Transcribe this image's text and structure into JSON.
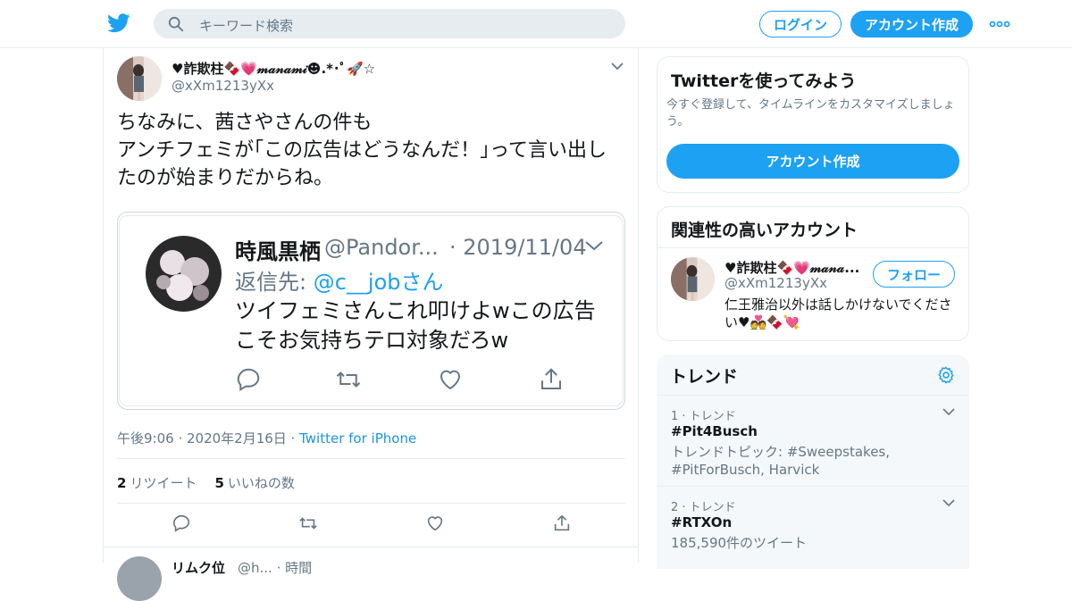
{
  "topbar": {
    "search_placeholder": "キーワード検索",
    "login_label": "ログイン",
    "signup_label": "アカウント作成"
  },
  "tweet": {
    "display_name": "♥詐欺柱🍫💗𝓂𝒶𝓃𝒶𝓂𝒾☻.*･ﾟ🚀☆",
    "handle": "@xXm1213yXx",
    "text": "ちなみに、茜さやさんの件も\nアンチフェミが｢この広告はどうなんだ！｣って言い出したのが始まりだからね。",
    "embedded": {
      "name": "時風黒栖",
      "handle": "@Pandor...",
      "date": "· 2019/11/04",
      "reply_prefix": "返信先: ",
      "reply_to": "@c__jobさん",
      "text": "ツイフェミさんこれ叩けよwこの広告\nこそお気持ちテロ対象だろw"
    },
    "timestamp": "午後9:06 · 2020年2月16日 · ",
    "source": "Twitter for iPhone",
    "retweet_count": "2",
    "retweet_label": "リツイート",
    "like_count": "5",
    "like_label": "いいねの数"
  },
  "next_tweet": {
    "name": "リムク位",
    "handle": "@h...  · 時間"
  },
  "signup_card": {
    "title": "Twitterを使ってみよう",
    "subtitle": "今すぐ登録して、タイムラインをカスタマイズしましょう。",
    "button": "アカウント作成"
  },
  "related_card": {
    "title": "関連性の高いアカウント",
    "name": "♥詐欺柱🍫💗𝓂𝒶𝓃𝒶...",
    "handle": "@xXm1213yXx",
    "follow_label": "フォロー",
    "bio": "仁王雅治以外は話しかけないでください♥💑🍫💘"
  },
  "trends": {
    "title": "トレンド",
    "items": [
      {
        "context": "1 · トレンド",
        "tag": "#Pit4Busch",
        "desc": "トレンドトピック: #Sweepstakes, #PitForBusch, Harvick"
      },
      {
        "context": "2 · トレンド",
        "tag": "#RTXOn",
        "desc": "185,590件のツイート"
      }
    ]
  },
  "colors": {
    "accent": "#1da1f2",
    "link": "#1b95e0",
    "muted": "#657786",
    "border": "#e6ecf0"
  },
  "icons": [
    "twitter-bird-icon",
    "search-icon",
    "more-dots-icon",
    "chevron-down-icon",
    "reply-icon",
    "retweet-icon",
    "like-icon",
    "share-icon",
    "gear-icon"
  ]
}
